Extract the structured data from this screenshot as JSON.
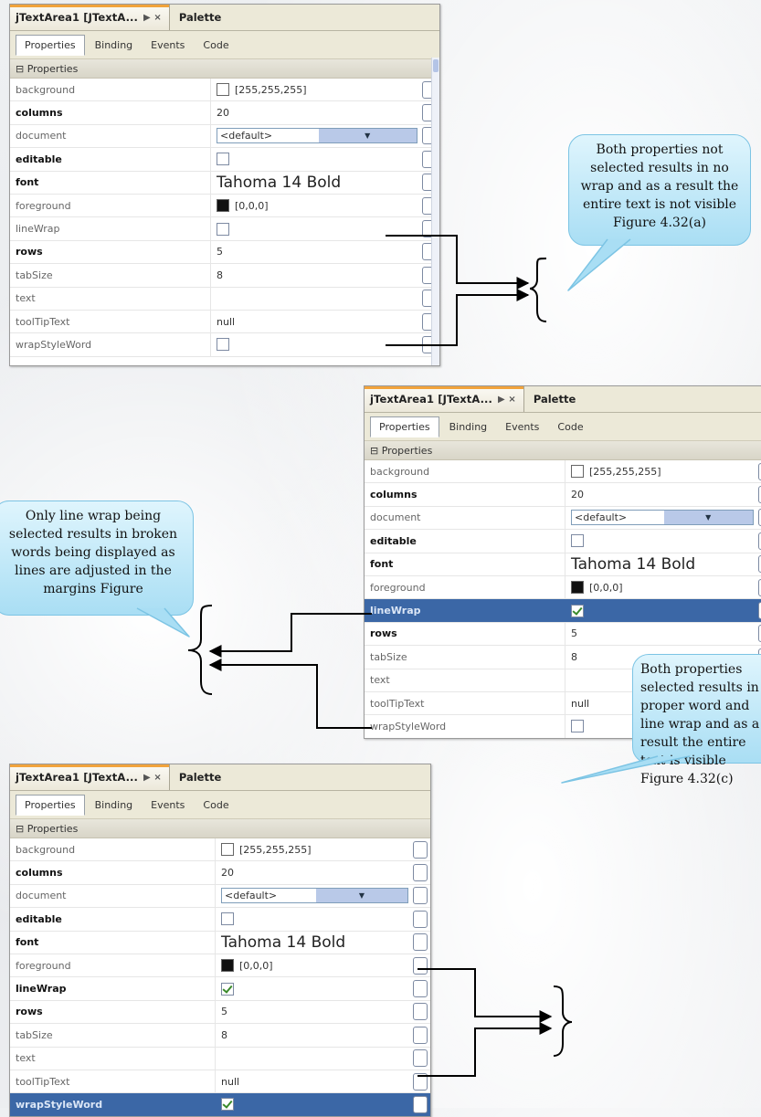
{
  "panel": {
    "title": "jTextArea1 [JTextA...",
    "tab_controls": "▶ ×",
    "palette_tab": "Palette",
    "subtabs": [
      "Properties",
      "Binding",
      "Events",
      "Code"
    ],
    "section": "Properties",
    "property_names": {
      "background": "background",
      "columns": "columns",
      "document": "document",
      "editable": "editable",
      "font": "font",
      "foreground": "foreground",
      "lineWrap": "lineWrap",
      "rows": "rows",
      "tabSize": "tabSize",
      "text": "text",
      "toolTipText": "toolTipText",
      "wrapStyleWord": "wrapStyleWord"
    },
    "property_values": {
      "background": "[255,255,255]",
      "columns": "20",
      "document": "<default>",
      "font": "Tahoma 14 Bold",
      "foreground": "[0,0,0]",
      "rows": "5",
      "tabSize": "8",
      "text": "",
      "toolTipText": "null"
    },
    "colors": {
      "background_swatch": "#ffffff",
      "foreground_swatch": "#111111",
      "selection": "#3b67a6"
    }
  },
  "states": [
    {
      "lineWrap": false,
      "wrapStyleWord": false,
      "highlighted": []
    },
    {
      "lineWrap": true,
      "wrapStyleWord": false,
      "highlighted": [
        "lineWrap"
      ]
    },
    {
      "lineWrap": true,
      "wrapStyleWord": true,
      "highlighted": [
        "wrapStyleWord"
      ]
    }
  ],
  "callouts": {
    "first": "Both properties not selected results in no wrap and as a result the entire text is not visible Figure 4.32(a)",
    "second": "Only line wrap being selected results in broken words being displayed as lines are adjusted in the margins Figure",
    "third": "Both properties selected results in proper word and line wrap and as a result the entire text is visible Figure 4.32(c)"
  }
}
